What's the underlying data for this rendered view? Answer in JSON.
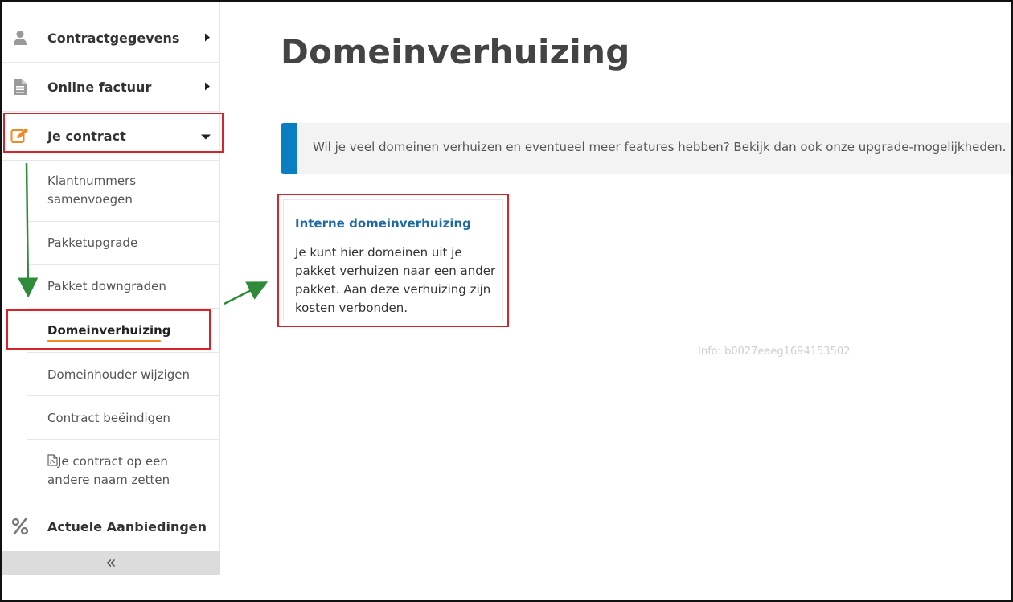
{
  "sidebar": {
    "items": [
      {
        "label": "Contractgegevens",
        "icon": "user-icon"
      },
      {
        "label": "Online factuur",
        "icon": "document-icon"
      },
      {
        "label": "Je contract",
        "icon": "edit-icon"
      },
      {
        "label": "Actuele Aanbiedingen",
        "icon": "percent-icon"
      }
    ],
    "subitems": [
      {
        "line1": "Klantnummers",
        "line2": "samenvoegen"
      },
      {
        "line1": "Pakketupgrade"
      },
      {
        "line1": "Pakket downgraden"
      },
      {
        "line1": "Domeinverhuizing"
      },
      {
        "line1": "Domeinhouder wijzigen"
      },
      {
        "line1": "Contract beëindigen"
      },
      {
        "line1": "Je contract op een",
        "line2": "andere naam zetten"
      }
    ],
    "collapse_label": "«"
  },
  "main": {
    "title": "Domeinverhuizing",
    "info_text": "Wil je veel domeinen verhuizen en eventueel meer features hebben? Bekijk dan ook onze upgrade-mogelijkheden.",
    "card": {
      "heading": "Interne domeinverhuizing",
      "body": "Je kunt hier domeinen uit je pakket verhuizen naar een ander pakket. Aan deze verhuizing zijn kosten verbonden."
    },
    "meta": "Info: b0027eaeg1694153502"
  },
  "colors": {
    "accent_orange": "#f08a24",
    "info_blue": "#0b7dc2",
    "link_blue": "#1f6aa5",
    "highlight_red": "#d9232a",
    "annotation_green": "#2e8b3a"
  }
}
